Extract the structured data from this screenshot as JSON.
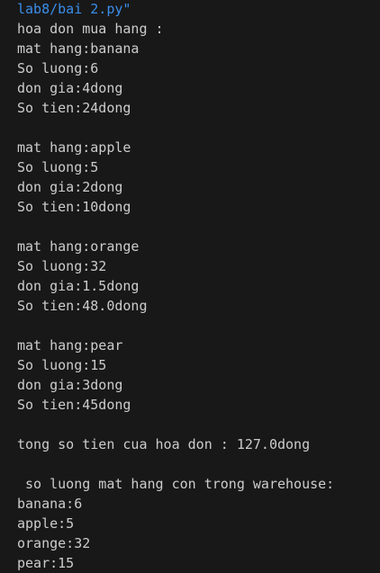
{
  "terminal": {
    "path_line": "lab8/bai 2.py\"",
    "header": "hoa don mua hang :",
    "items": [
      {
        "name_line": "mat hang:banana",
        "qty_line": "So luong:6",
        "price_line": "don gia:4dong",
        "total_line": "So tien:24dong"
      },
      {
        "name_line": "mat hang:apple",
        "qty_line": "So luong:5",
        "price_line": "don gia:2dong",
        "total_line": "So tien:10dong"
      },
      {
        "name_line": "mat hang:orange",
        "qty_line": "So luong:32",
        "price_line": "don gia:1.5dong",
        "total_line": "So tien:48.0dong"
      },
      {
        "name_line": "mat hang:pear",
        "qty_line": "So luong:15",
        "price_line": "don gia:3dong",
        "total_line": "So tien:45dong"
      }
    ],
    "grand_total_line": "tong so tien cua hoa don : 127.0dong",
    "warehouse_header": " so luong mat hang con trong warehouse:",
    "warehouse": [
      "banana:6",
      "apple:5",
      "orange:32",
      "pear:15"
    ]
  }
}
